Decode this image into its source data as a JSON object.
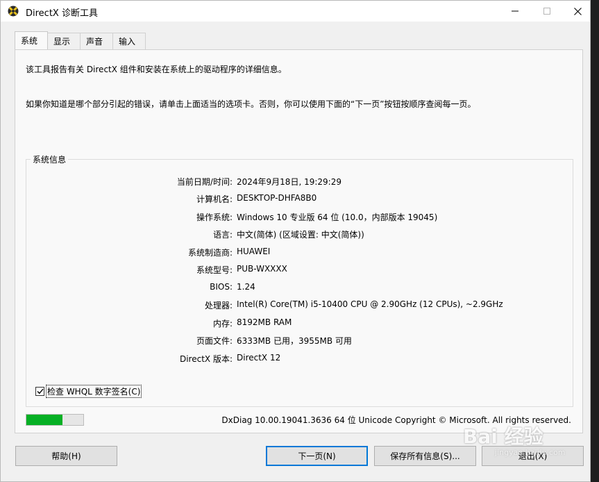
{
  "window": {
    "title": "DirectX 诊断工具"
  },
  "tabs": [
    {
      "label": "系统",
      "active": true
    },
    {
      "label": "显示",
      "active": false
    },
    {
      "label": "声音",
      "active": false
    },
    {
      "label": "输入",
      "active": false
    }
  ],
  "intro": {
    "line1": "该工具报告有关 DirectX 组件和安装在系统上的驱动程序的详细信息。",
    "line2": "如果你知道是哪个部分引起的错误，请单击上面适当的选项卡。否则，你可以使用下面的“下一页”按钮按顺序查阅每一页。"
  },
  "system_info": {
    "group_title": "系统信息",
    "rows": [
      {
        "label": "当前日期/时间:",
        "value": "2024年9月18日, 19:29:29"
      },
      {
        "label": "计算机名:",
        "value": "DESKTOP-DHFA8B0"
      },
      {
        "label": "操作系统:",
        "value": "Windows 10 专业版 64 位 (10.0，内部版本 19045)"
      },
      {
        "label": "语言:",
        "value": "中文(简体) (区域设置: 中文(简体))"
      },
      {
        "label": "系统制造商:",
        "value": "HUAWEI"
      },
      {
        "label": "系统型号:",
        "value": "PUB-WXXXX"
      },
      {
        "label": "BIOS:",
        "value": "1.24"
      },
      {
        "label": "处理器:",
        "value": "Intel(R) Core(TM) i5-10400 CPU @ 2.90GHz (12 CPUs), ~2.9GHz"
      },
      {
        "label": "内存:",
        "value": "8192MB RAM"
      },
      {
        "label": "页面文件:",
        "value": "6333MB 已用，3955MB 可用"
      },
      {
        "label": "DirectX 版本:",
        "value": "DirectX 12"
      }
    ],
    "whql_label": "检查 WHQL 数字签名(C)",
    "whql_checked": true
  },
  "status": {
    "progress": 0.63,
    "version_text": "DxDiag 10.00.19041.3636 64 位 Unicode  Copyright © Microsoft. All rights reserved."
  },
  "buttons": {
    "help": "帮助(H)",
    "next": "下一页(N)",
    "save": "保存所有信息(S)...",
    "exit": "退出(X)"
  },
  "watermark": {
    "text": "Bai 经验",
    "sub": "jingyan.baidu.com"
  },
  "colors": {
    "progress_fill": "#06b025",
    "default_button_border": "#0078d7"
  }
}
